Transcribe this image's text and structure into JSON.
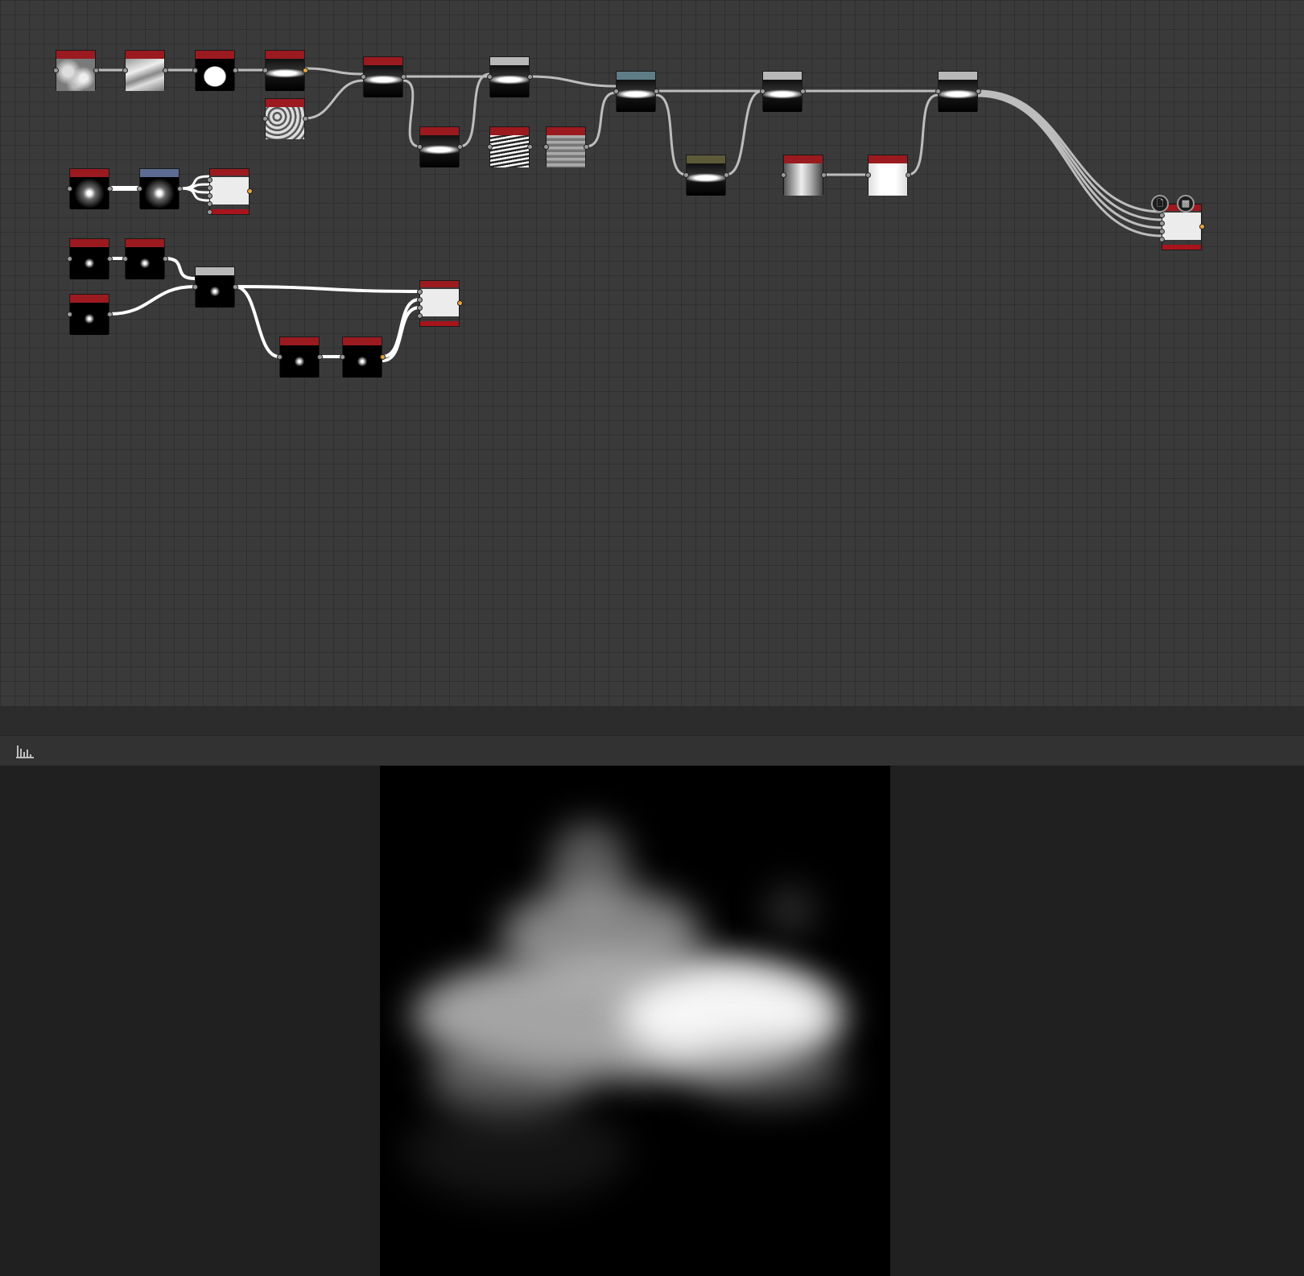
{
  "app": {
    "panels": {
      "graph": "node-graph-editor",
      "viewer": "2d-preview"
    }
  },
  "toolbar": {
    "histogram_icon": "histogram-icon"
  },
  "output_badges": [
    {
      "icon": "document-icon",
      "glyph": "🗋"
    },
    {
      "icon": "checker-icon",
      "glyph": "▩"
    }
  ],
  "colors": {
    "graph_bg": "#3a3a3a",
    "node_header_red": "#9b1a1f",
    "node_header_gray": "#b8b8b8",
    "node_header_teal": "#5f7d86",
    "node_header_olive": "#5d5a3a",
    "node_header_blue": "#5c6b91",
    "wire": "#bdbdbd",
    "viewer_bg": "#202020"
  }
}
